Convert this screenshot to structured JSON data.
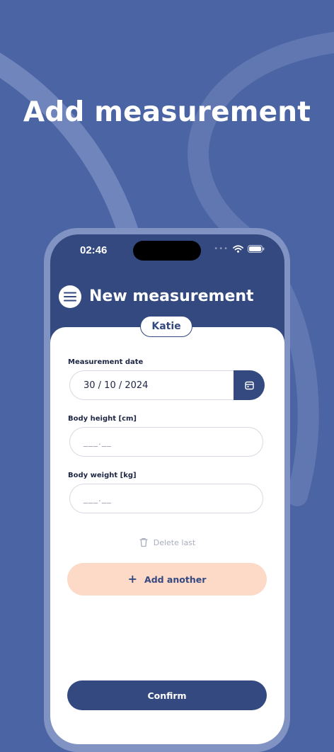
{
  "headline": "Add measurement",
  "status_bar": {
    "time": "02:46",
    "signal_dots": "•••"
  },
  "header": {
    "title": "New measurement",
    "menu_icon": "menu-icon"
  },
  "profile": {
    "name": "Katie"
  },
  "form": {
    "date_label": "Measurement date",
    "date_value": "30 / 10 / 2024",
    "height_label": "Body height [cm]",
    "height_placeholder": "___.__",
    "weight_label": "Body weight [kg]",
    "weight_placeholder": "___.__"
  },
  "actions": {
    "delete_last": "Delete last",
    "add_another_plus": "+",
    "add_another": "Add another",
    "confirm": "Confirm"
  },
  "colors": {
    "background": "#4a64a4",
    "primary": "#34497f",
    "accent_peach": "#fdd9c8",
    "card": "#ffffff"
  }
}
